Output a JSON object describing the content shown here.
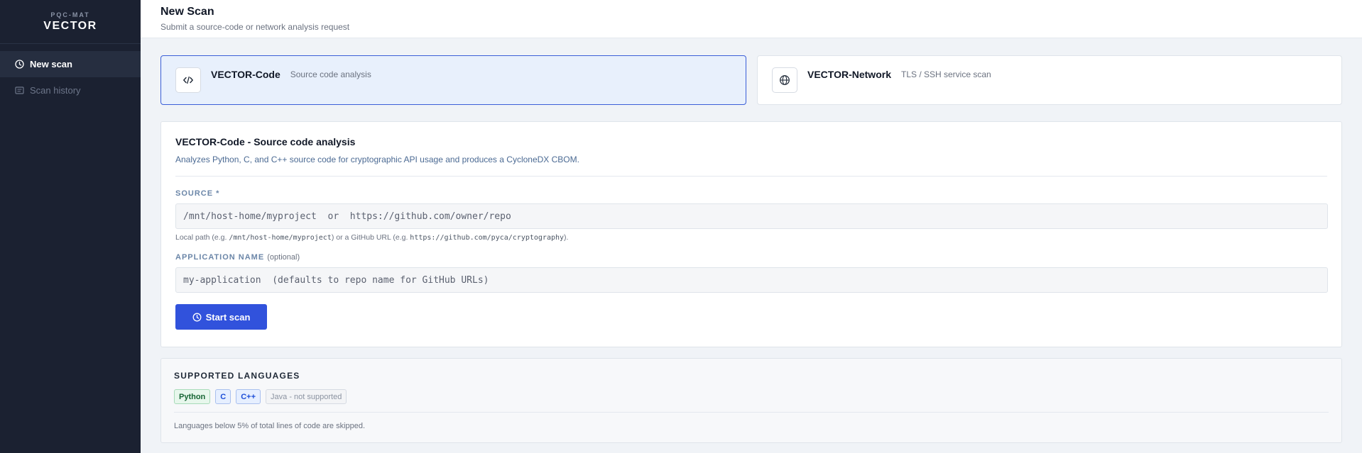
{
  "brand": {
    "sub": "PQC-MAT",
    "main": "VECTOR"
  },
  "sidebar": {
    "items": [
      {
        "label": "New scan",
        "icon": "clock-icon",
        "active": true
      },
      {
        "label": "Scan history",
        "icon": "list-icon",
        "active": false
      }
    ]
  },
  "header": {
    "title": "New Scan",
    "subtitle": "Submit a source-code or network analysis request"
  },
  "tools": [
    {
      "name": "VECTOR-Code",
      "desc": "Source code analysis",
      "icon": "code-icon",
      "selected": true
    },
    {
      "name": "VECTOR-Network",
      "desc": "TLS / SSH service scan",
      "icon": "globe-icon",
      "selected": false
    }
  ],
  "form": {
    "title": "VECTOR-Code - Source code analysis",
    "description": "Analyzes Python, C, and C++ source code for cryptographic API usage and produces a CycloneDX CBOM.",
    "source": {
      "label": "SOURCE *",
      "value": "",
      "placeholder": "/mnt/host-home/myproject  or  https://github.com/owner/repo",
      "hint_prefix": "Local path (e.g. ",
      "hint_path": "/mnt/host-home/myproject",
      "hint_middle": ") or a GitHub URL (e.g. ",
      "hint_url": "https://github.com/pyca/cryptography",
      "hint_suffix": ")."
    },
    "app_name": {
      "label": "APPLICATION NAME",
      "optional": "(optional)",
      "value": "",
      "placeholder": "my-application  (defaults to repo name for GitHub URLs)"
    },
    "submit_label": "Start scan"
  },
  "languages": {
    "title": "SUPPORTED LANGUAGES",
    "badges": [
      {
        "label": "Python",
        "status": "supported"
      },
      {
        "label": "C",
        "status": "supported"
      },
      {
        "label": "C++",
        "status": "supported"
      },
      {
        "label": "Java - not supported",
        "status": "unsupported"
      }
    ],
    "note": "Languages below 5% of total lines of code are skipped."
  },
  "colors": {
    "sidebar_bg": "#1b2131",
    "accent": "#3152dc",
    "selected_card_bg": "#e8f0fc",
    "python_badge": "#e7f7ec",
    "c_badge": "#e6efff"
  }
}
